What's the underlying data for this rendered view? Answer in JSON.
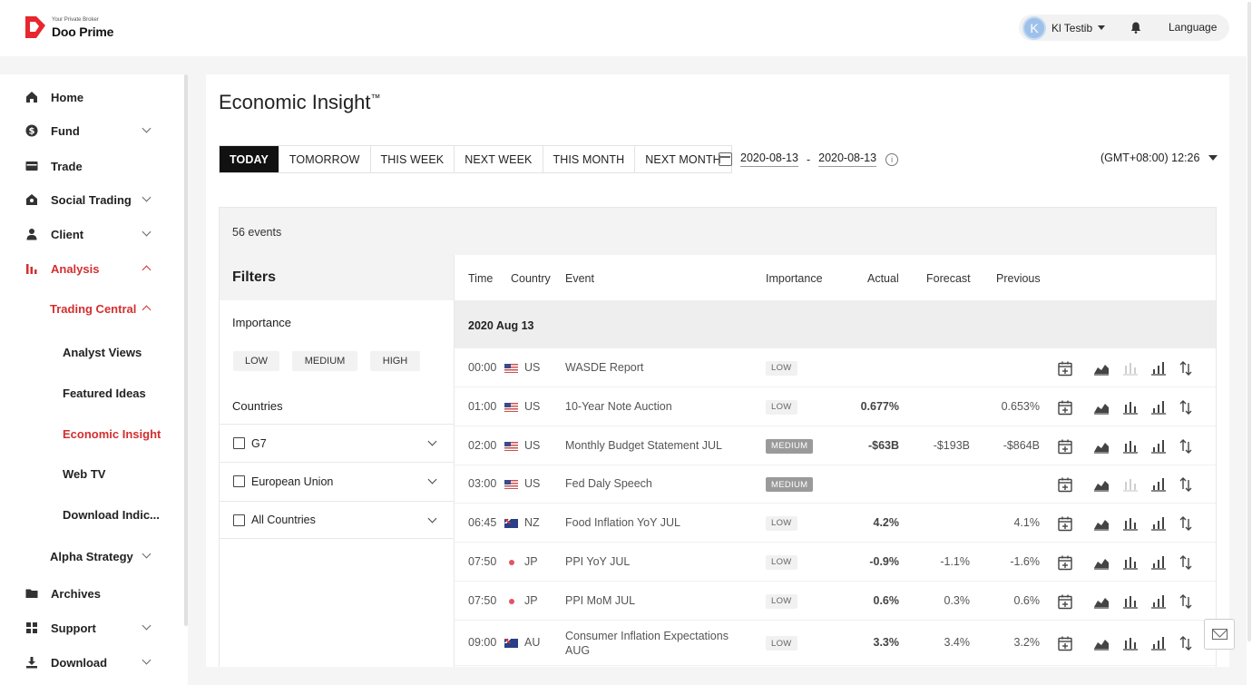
{
  "header": {
    "logo_tag": "Your Private Broker",
    "logo_name": "Doo Prime",
    "user_initial": "K",
    "user_name": "Kl Testib",
    "language": "Language"
  },
  "sidebar": {
    "items": [
      {
        "label": "Home",
        "icon": "home-icon"
      },
      {
        "label": "Fund",
        "icon": "dollar-icon"
      },
      {
        "label": "Trade",
        "icon": "card-icon"
      },
      {
        "label": "Social Trading",
        "icon": "social-icon"
      },
      {
        "label": "Client",
        "icon": "person-icon"
      },
      {
        "label": "Analysis",
        "icon": "bar-chart-icon"
      },
      {
        "label": "Archives",
        "icon": "folder-icon"
      },
      {
        "label": "Support",
        "icon": "grid-icon"
      },
      {
        "label": "Download",
        "icon": "download-icon"
      }
    ],
    "trading_central": "Trading Central",
    "sub_items": [
      "Analyst Views",
      "Featured Ideas",
      "Economic Insight",
      "Web TV",
      "Download Indic..."
    ],
    "alpha_strategy": "Alpha Strategy"
  },
  "main": {
    "title": "Economic Insight",
    "title_mark": "™",
    "tabs": [
      "TODAY",
      "TOMORROW",
      "THIS WEEK",
      "NEXT WEEK",
      "THIS MONTH",
      "NEXT MONTH"
    ],
    "date_from": "2020-08-13",
    "date_sep": "-",
    "date_to": "2020-08-13",
    "timezone": "(GMT+08:00) 12:26",
    "events_count": "56 events"
  },
  "filters": {
    "title": "Filters",
    "importance_label": "Importance",
    "importance_options": [
      "LOW",
      "MEDIUM",
      "HIGH"
    ],
    "countries_label": "Countries",
    "countries": [
      "G7",
      "European Union",
      "All Countries"
    ]
  },
  "table": {
    "headers": [
      "Time",
      "Country",
      "Event",
      "Importance",
      "Actual",
      "Forecast",
      "Previous"
    ],
    "date_group": "2020 Aug 13",
    "rows": [
      {
        "time": "00:00",
        "flag": "us",
        "country": "US",
        "event": "WASDE Report",
        "event2": "",
        "importance": "LOW",
        "actual": "",
        "forecast": "",
        "previous": ""
      },
      {
        "time": "01:00",
        "flag": "us",
        "country": "US",
        "event": "10-Year Note Auction",
        "event2": "",
        "importance": "LOW",
        "actual": "0.677%",
        "forecast": "",
        "previous": "0.653%"
      },
      {
        "time": "02:00",
        "flag": "us",
        "country": "US",
        "event": "Monthly Budget Statement JUL",
        "event2": "",
        "importance": "MEDIUM",
        "actual": "-$63B",
        "forecast": "-$193B",
        "previous": "-$864B"
      },
      {
        "time": "03:00",
        "flag": "us",
        "country": "US",
        "event": "Fed Daly Speech",
        "event2": "",
        "importance": "MEDIUM",
        "actual": "",
        "forecast": "",
        "previous": ""
      },
      {
        "time": "06:45",
        "flag": "au",
        "country": "NZ",
        "event": "Food Inflation YoY JUL",
        "event2": "",
        "importance": "LOW",
        "actual": "4.2%",
        "forecast": "",
        "previous": "4.1%"
      },
      {
        "time": "07:50",
        "flag": "jp",
        "country": "JP",
        "event": "PPI YoY JUL",
        "event2": "",
        "importance": "LOW",
        "actual": "-0.9%",
        "forecast": "-1.1%",
        "previous": "-1.6%"
      },
      {
        "time": "07:50",
        "flag": "jp",
        "country": "JP",
        "event": "PPI MoM JUL",
        "event2": "",
        "importance": "LOW",
        "actual": "0.6%",
        "forecast": "0.3%",
        "previous": "0.6%"
      },
      {
        "time": "09:00",
        "flag": "au",
        "country": "AU",
        "event": "Consumer Inflation Expectations",
        "event2": "AUG",
        "importance": "LOW",
        "actual": "3.3%",
        "forecast": "3.4%",
        "previous": "3.2%"
      }
    ]
  },
  "colors": {
    "accent": "#d32f2f",
    "active_tab": "#111111"
  }
}
